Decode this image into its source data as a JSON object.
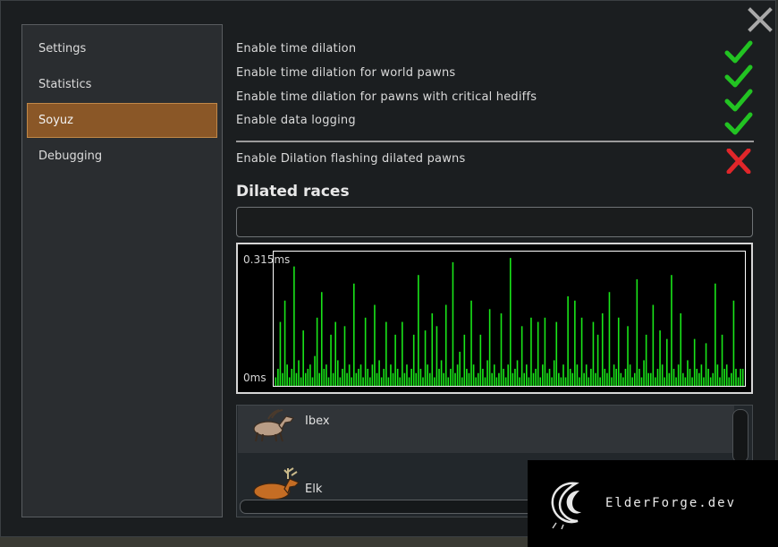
{
  "sidebar": {
    "items": [
      {
        "label": "Settings",
        "active": false
      },
      {
        "label": "Statistics",
        "active": false
      },
      {
        "label": "Soyuz",
        "active": true
      },
      {
        "label": "Debugging",
        "active": false
      }
    ]
  },
  "options": [
    {
      "label": "Enable time dilation",
      "enabled": true,
      "icon": "check-icon"
    },
    {
      "label": "Enable time dilation for world pawns",
      "enabled": true,
      "icon": "check-icon"
    },
    {
      "label": "Enable time dilation for pawns with critical hediffs",
      "enabled": true,
      "icon": "check-icon"
    },
    {
      "label": "Enable data logging",
      "enabled": true,
      "icon": "check-icon"
    },
    {
      "label": "Enable Dilation flashing dilated pawns",
      "enabled": false,
      "icon": "cross-icon"
    }
  ],
  "dilated_races": {
    "title": "Dilated races",
    "search_value": ""
  },
  "graph": {
    "max_label": "0.315ms",
    "min_label": "0ms",
    "max_value_ms": 0.315
  },
  "races": [
    {
      "name": "Ibex",
      "icon": "ibex-icon"
    },
    {
      "name": "Elk",
      "icon": "elk-icon"
    }
  ],
  "watermark": {
    "text": "ElderForge.dev",
    "icon": "dragon-logo-icon"
  },
  "colors": {
    "accent": "#8a5727",
    "check": "#22c322",
    "cross": "#e0262a",
    "graph_line": "#19e619"
  },
  "chart_data": {
    "type": "bar",
    "ylim": [
      0,
      0.315
    ],
    "ylabel_max": "0.315ms",
    "ylabel_min": "0ms",
    "values": [
      0.02,
      0.04,
      0.15,
      0.03,
      0.2,
      0.05,
      0.02,
      0.04,
      0.28,
      0.03,
      0.06,
      0.02,
      0.13,
      0.03,
      0.04,
      0.05,
      0.02,
      0.07,
      0.16,
      0.03,
      0.22,
      0.04,
      0.05,
      0.02,
      0.12,
      0.03,
      0.15,
      0.06,
      0.02,
      0.04,
      0.14,
      0.03,
      0.05,
      0.02,
      0.24,
      0.03,
      0.04,
      0.05,
      0.02,
      0.16,
      0.04,
      0.02,
      0.05,
      0.19,
      0.03,
      0.06,
      0.02,
      0.04,
      0.15,
      0.02,
      0.05,
      0.03,
      0.12,
      0.04,
      0.02,
      0.15,
      0.03,
      0.05,
      0.02,
      0.04,
      0.12,
      0.03,
      0.26,
      0.04,
      0.02,
      0.13,
      0.05,
      0.03,
      0.17,
      0.02,
      0.14,
      0.04,
      0.06,
      0.03,
      0.19,
      0.02,
      0.04,
      0.29,
      0.03,
      0.05,
      0.08,
      0.02,
      0.12,
      0.04,
      0.03,
      0.2,
      0.05,
      0.02,
      0.03,
      0.12,
      0.04,
      0.02,
      0.06,
      0.18,
      0.03,
      0.05,
      0.02,
      0.03,
      0.17,
      0.04,
      0.02,
      0.05,
      0.3,
      0.03,
      0.04,
      0.06,
      0.02,
      0.14,
      0.03,
      0.05,
      0.02,
      0.16,
      0.03,
      0.04,
      0.15,
      0.02,
      0.05,
      0.16,
      0.03,
      0.04,
      0.02,
      0.06,
      0.15,
      0.03,
      0.02,
      0.05,
      0.02,
      0.21,
      0.04,
      0.03,
      0.2,
      0.05,
      0.02,
      0.16,
      0.03,
      0.05,
      0.02,
      0.04,
      0.15,
      0.03,
      0.12,
      0.02,
      0.17,
      0.04,
      0.03,
      0.22,
      0.02,
      0.05,
      0.04,
      0.16,
      0.03,
      0.02,
      0.04,
      0.14,
      0.05,
      0.02,
      0.03,
      0.25,
      0.04,
      0.02,
      0.06,
      0.12,
      0.03,
      0.03,
      0.19,
      0.02,
      0.04,
      0.13,
      0.05,
      0.02,
      0.11,
      0.03,
      0.26,
      0.04,
      0.02,
      0.05,
      0.17,
      0.03,
      0.02,
      0.06,
      0.04,
      0.02,
      0.11,
      0.04,
      0.03,
      0.05,
      0.02,
      0.1,
      0.04,
      0.02,
      0.03,
      0.24,
      0.05,
      0.02,
      0.12,
      0.04,
      0.05,
      0.02,
      0.03,
      0.2,
      0.04,
      0.02,
      0.04,
      0.04
    ]
  }
}
